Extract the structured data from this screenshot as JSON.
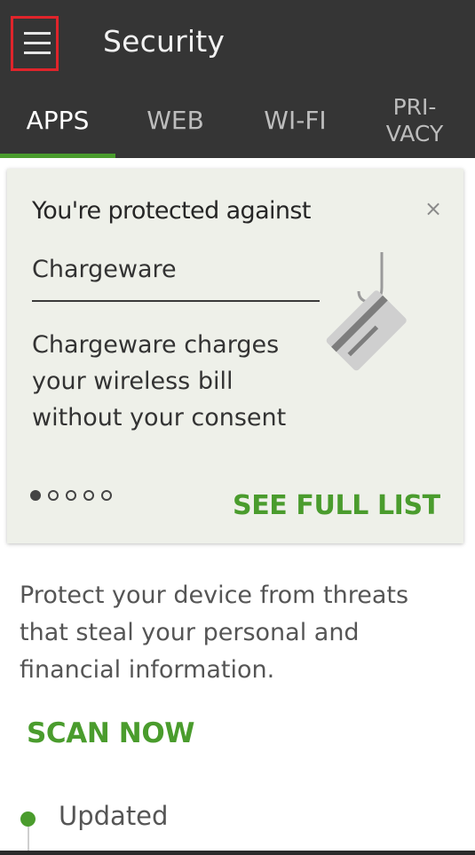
{
  "header": {
    "title": "Security",
    "menu_icon": "hamburger-menu-icon"
  },
  "tabs": [
    {
      "label": "APPS",
      "active": true
    },
    {
      "label": "WEB",
      "active": false
    },
    {
      "label": "WI-FI",
      "active": false
    },
    {
      "label": "PRI-\nVACY",
      "active": false
    }
  ],
  "card": {
    "heading": "You're protected against",
    "threat_name": "Chargeware",
    "description": "Chargeware charges your wireless bill without your consent",
    "close_label": "×",
    "illustration_icon": "credit-card-hook-icon",
    "pagination": {
      "total": 5,
      "current": 1
    },
    "cta_label": "SEE FULL LIST"
  },
  "main": {
    "description": "Protect your device from threats that steal your personal and financial information.",
    "scan_label": "SCAN NOW",
    "status_label": "Updated"
  },
  "colors": {
    "appbar": "#353535",
    "accent_green": "#4a9c2d",
    "card_bg": "#eef0e9",
    "highlight_red": "#e0242b"
  }
}
